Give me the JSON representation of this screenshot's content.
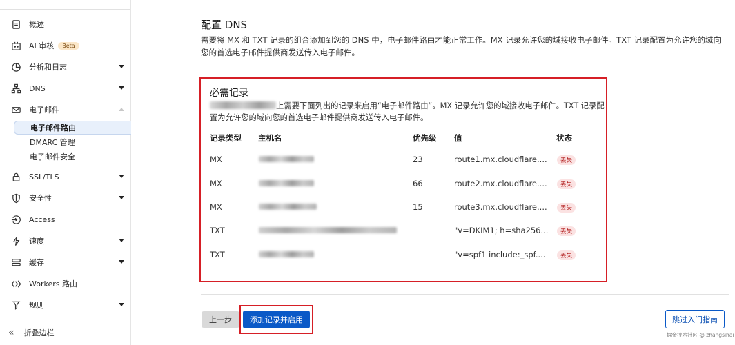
{
  "sidebar": {
    "items": [
      {
        "label": "概述",
        "icon": "document-icon"
      },
      {
        "label": "AI 审核",
        "icon": "ai-audit-icon",
        "badge": "Beta"
      },
      {
        "label": "分析和日志",
        "icon": "pie-chart-icon"
      },
      {
        "label": "DNS",
        "icon": "network-tree-icon"
      },
      {
        "label": "电子邮件",
        "icon": "email-icon"
      },
      {
        "label": "SSL/TLS",
        "icon": "lock-icon"
      },
      {
        "label": "安全性",
        "icon": "shield-icon"
      },
      {
        "label": "Access",
        "icon": "access-icon"
      },
      {
        "label": "速度",
        "icon": "lightning-icon"
      },
      {
        "label": "缓存",
        "icon": "cache-stack-icon"
      },
      {
        "label": "Workers 路由",
        "icon": "workers-icon"
      },
      {
        "label": "规则",
        "icon": "rules-funnel-icon"
      }
    ],
    "email_sub": [
      "电子邮件路由",
      "DMARC 管理",
      "电子邮件安全"
    ],
    "collapse_label": "折叠边栏"
  },
  "main": {
    "title": "配置 DNS",
    "description": "需要将 MX 和 TXT 记录的组合添加到您的 DNS 中，电子邮件路由才能正常工作。MX 记录允许您的域接收电子邮件。TXT 记录配置为允许您的域向您的首选电子邮件提供商发送传入电子邮件。"
  },
  "records": {
    "title": "必需记录",
    "description_rest": "上需要下面列出的记录来启用“电子邮件路由”。MX 记录允许您的域接收电子邮件。TXT 记录配置为允许您的域向您的首选电子邮件提供商发送传入电子邮件。",
    "headers": {
      "type": "记录类型",
      "host": "主机名",
      "priority": "优先级",
      "value": "值",
      "status": "状态"
    },
    "rows": [
      {
        "type": "MX",
        "priority": "23",
        "value": "route1.mx.cloudflare....",
        "status": "丢失"
      },
      {
        "type": "MX",
        "priority": "66",
        "value": "route2.mx.cloudflare....",
        "status": "丢失"
      },
      {
        "type": "MX",
        "priority": "15",
        "value": "route3.mx.cloudflare....",
        "status": "丢失"
      },
      {
        "type": "TXT",
        "priority": "",
        "value": "\"v=DKIM1; h=sha256...",
        "status": "丢失"
      },
      {
        "type": "TXT",
        "priority": "",
        "value": "\"v=spf1 include:_spf....",
        "status": "丢失"
      }
    ]
  },
  "buttons": {
    "prev": "上一步",
    "add": "添加记录并启用",
    "skip": "跳过入门指南"
  },
  "watermark": "掘金技术社区 @ zhangsihai",
  "colors": {
    "primary": "#0a59c7",
    "highlight": "#d61f26",
    "badge_bg": "#fbe2e2"
  }
}
